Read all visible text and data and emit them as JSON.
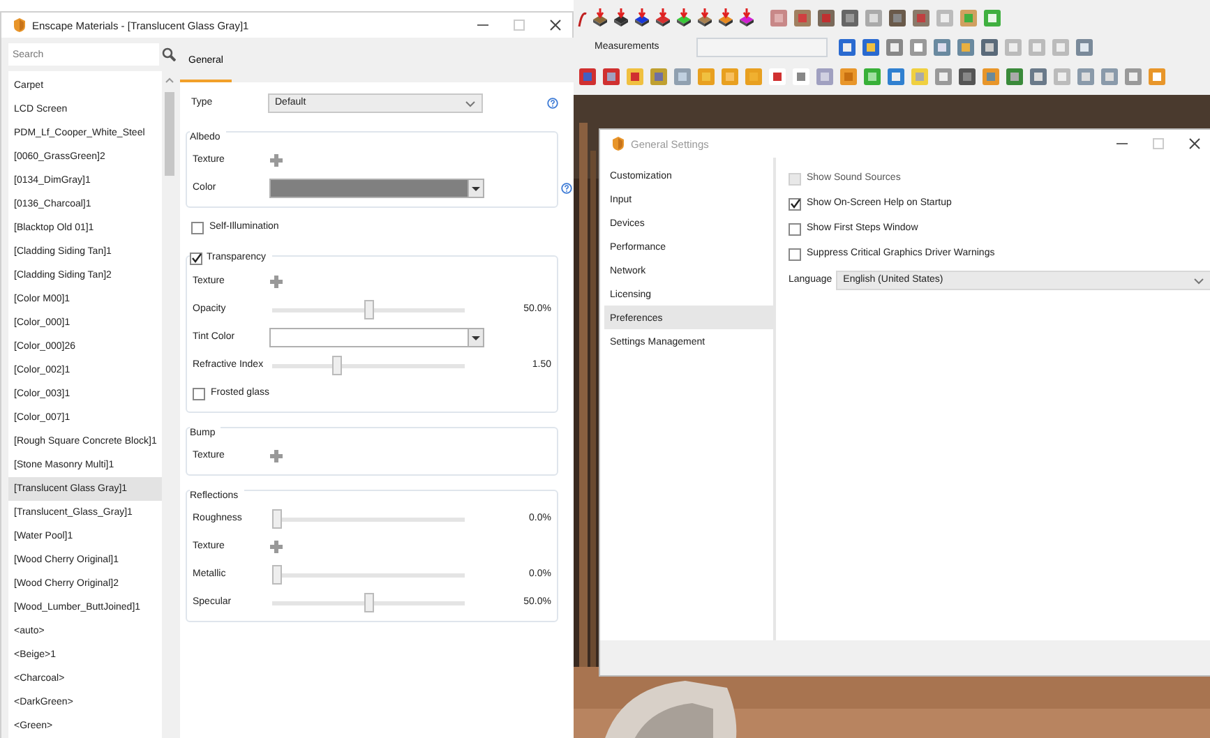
{
  "materials_window": {
    "title": "Enscape Materials - [Translucent Glass Gray]1",
    "search": {
      "placeholder": "Search"
    },
    "materials": [
      {
        "label": "Carpet",
        "selected": false
      },
      {
        "label": "LCD Screen",
        "selected": false
      },
      {
        "label": "PDM_Lf_Cooper_White_Steel",
        "selected": false
      },
      {
        "label": "[0060_GrassGreen]2",
        "selected": false
      },
      {
        "label": "[0134_DimGray]1",
        "selected": false
      },
      {
        "label": "[0136_Charcoal]1",
        "selected": false
      },
      {
        "label": "[Blacktop Old 01]1",
        "selected": false
      },
      {
        "label": "[Cladding Siding Tan]1",
        "selected": false
      },
      {
        "label": "[Cladding Siding Tan]2",
        "selected": false
      },
      {
        "label": "[Color M00]1",
        "selected": false
      },
      {
        "label": "[Color_000]1",
        "selected": false
      },
      {
        "label": "[Color_000]26",
        "selected": false
      },
      {
        "label": "[Color_002]1",
        "selected": false
      },
      {
        "label": "[Color_003]1",
        "selected": false
      },
      {
        "label": "[Color_007]1",
        "selected": false
      },
      {
        "label": "[Rough Square Concrete Block]1",
        "selected": false
      },
      {
        "label": "[Stone Masonry Multi]1",
        "selected": false
      },
      {
        "label": "[Translucent Glass Gray]1",
        "selected": true
      },
      {
        "label": "[Translucent_Glass_Gray]1",
        "selected": false
      },
      {
        "label": "[Water Pool]1",
        "selected": false
      },
      {
        "label": "[Wood Cherry Original]1",
        "selected": false
      },
      {
        "label": "[Wood Cherry Original]2",
        "selected": false
      },
      {
        "label": "[Wood_Lumber_ButtJoined]1",
        "selected": false
      },
      {
        "label": "<auto>",
        "selected": false
      },
      {
        "label": "<Beige>1",
        "selected": false
      },
      {
        "label": "<Charcoal>",
        "selected": false
      },
      {
        "label": "<DarkGreen>",
        "selected": false
      },
      {
        "label": "<Green>",
        "selected": false
      }
    ],
    "tabs": [
      {
        "label": "General",
        "selected": true
      }
    ],
    "form": [
      {
        "kind": "select",
        "label": "Type",
        "value": "Default",
        "help": true
      },
      {
        "kind": "group",
        "legend": "Albedo",
        "rows": [
          {
            "kind": "texture",
            "label": "Texture"
          },
          {
            "kind": "color",
            "label": "Color",
            "color": "#808080",
            "help": true
          }
        ]
      },
      {
        "kind": "checkbox",
        "label": "Self-Illumination",
        "checked": false
      },
      {
        "kind": "group",
        "legend": "Transparency",
        "legend_checked": true,
        "rows": [
          {
            "kind": "texture",
            "label": "Texture"
          },
          {
            "kind": "slider",
            "label": "Opacity",
            "level": 0.5,
            "reading": "50.0%"
          },
          {
            "kind": "color",
            "label": "Tint Color",
            "color": "#ffffff"
          },
          {
            "kind": "slider",
            "label": "Refractive Index",
            "level": 0.33,
            "reading": "1.50"
          },
          {
            "kind": "checkbox",
            "label": "Frosted glass",
            "checked": false
          }
        ]
      },
      {
        "kind": "group",
        "legend": "Bump",
        "rows": [
          {
            "kind": "texture",
            "label": "Texture"
          }
        ]
      },
      {
        "kind": "group",
        "legend": "Reflections",
        "rows": [
          {
            "kind": "slider",
            "label": "Roughness",
            "level": 0,
            "reading": "0.0%"
          },
          {
            "kind": "texture",
            "label": "Texture"
          },
          {
            "kind": "slider",
            "label": "Metallic",
            "level": 0,
            "reading": "0.0%"
          },
          {
            "kind": "slider",
            "label": "Specular",
            "level": 0.5,
            "reading": "50.0%"
          }
        ]
      }
    ]
  },
  "toolbar": {
    "measurements": {
      "label": "Measurements"
    }
  },
  "settings_window": {
    "title": "General Settings",
    "nav": [
      {
        "label": "Customization",
        "selected": false
      },
      {
        "label": "Input",
        "selected": false
      },
      {
        "label": "Devices",
        "selected": false
      },
      {
        "label": "Performance",
        "selected": false
      },
      {
        "label": "Network",
        "selected": false
      },
      {
        "label": "Licensing",
        "selected": false
      },
      {
        "label": "Preferences",
        "selected": true
      },
      {
        "label": "Settings Management",
        "selected": false
      }
    ],
    "options": [
      {
        "label": "Show Sound Sources",
        "checked": false,
        "disabled": true
      },
      {
        "label": "Show On-Screen Help on Startup",
        "checked": true,
        "disabled": false
      },
      {
        "label": "Show First Steps Window",
        "checked": false,
        "disabled": false
      },
      {
        "label": "Suppress Critical Graphics Driver Warnings",
        "checked": false,
        "disabled": false
      }
    ],
    "language": {
      "label": "Language",
      "value": "English (United States)"
    }
  }
}
